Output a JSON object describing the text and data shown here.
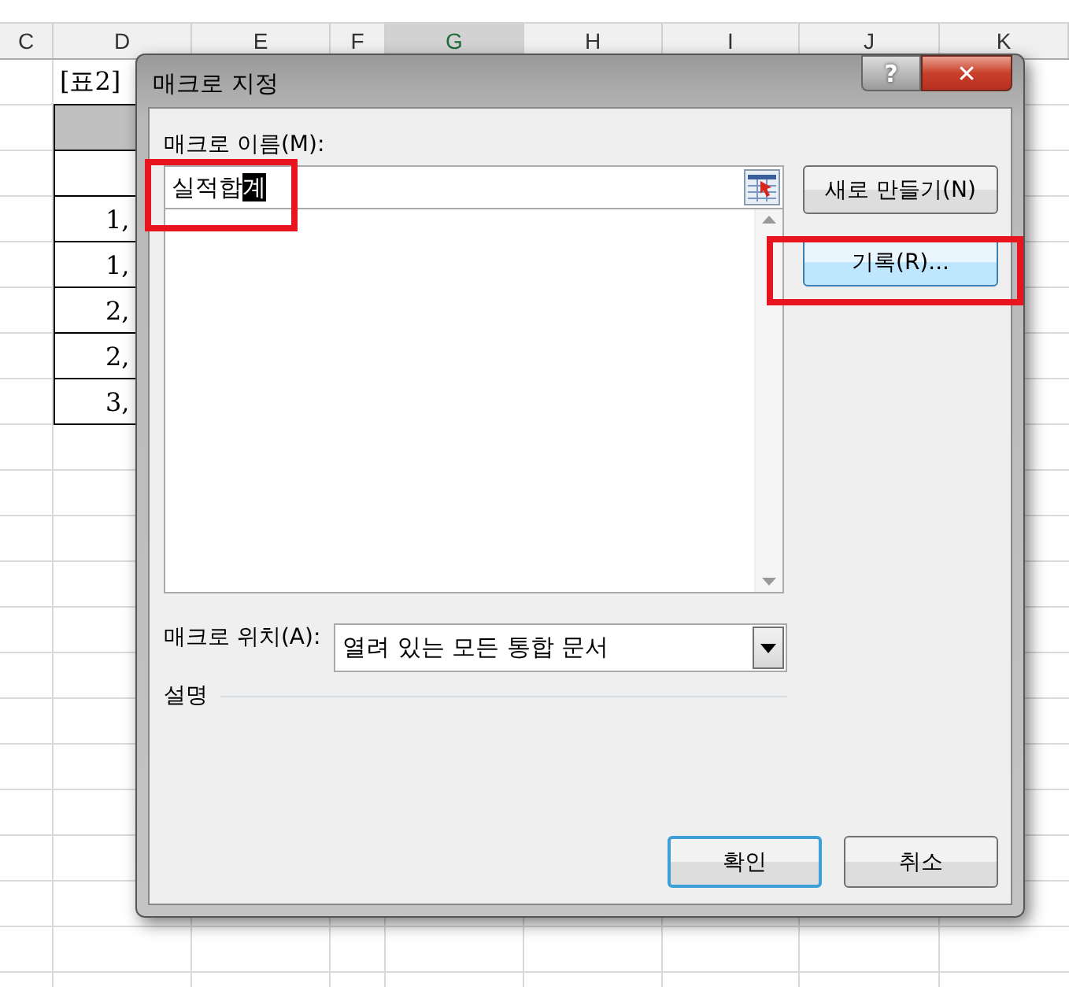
{
  "sheet": {
    "columns": [
      {
        "label": "C",
        "selected": false
      },
      {
        "label": "D",
        "selected": false
      },
      {
        "label": "E",
        "selected": false
      },
      {
        "label": "F",
        "selected": false
      },
      {
        "label": "G",
        "selected": true
      },
      {
        "label": "H",
        "selected": false
      },
      {
        "label": "I",
        "selected": false
      },
      {
        "label": "J",
        "selected": false
      },
      {
        "label": "K",
        "selected": false
      }
    ],
    "column_d": [
      {
        "kind": "title",
        "text": "[표2]"
      },
      {
        "kind": "header"
      },
      {
        "kind": "blank"
      },
      {
        "kind": "value",
        "text": "1,"
      },
      {
        "kind": "value",
        "text": "1,"
      },
      {
        "kind": "value",
        "text": "2,"
      },
      {
        "kind": "value",
        "text": "2,"
      },
      {
        "kind": "value",
        "text": "3,"
      }
    ]
  },
  "dialog": {
    "title": "매크로 지정",
    "help": "?",
    "close": "✕",
    "name_label": "매크로 이름(M):",
    "name_field": {
      "text": "실적합",
      "selected_text": "계",
      "highlighted": true
    },
    "buttons_side": [
      {
        "label": "새로 만들기(N)",
        "hover": false,
        "highlighted": false
      },
      {
        "label": "기록(R)...",
        "hover": true,
        "highlighted": true
      }
    ],
    "location_label": "매크로 위치(A):",
    "location_value": "열려 있는 모든 통합 문서",
    "description_label": "설명",
    "buttons": [
      {
        "label": "확인",
        "default": true
      },
      {
        "label": "취소",
        "default": false
      }
    ]
  }
}
